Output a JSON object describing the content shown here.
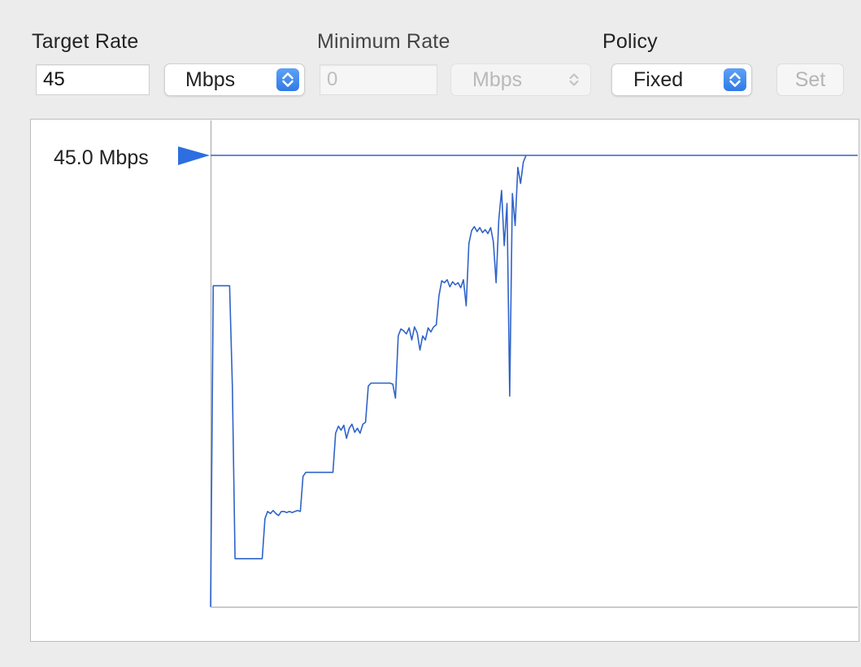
{
  "controls": {
    "target_rate": {
      "label": "Target Rate",
      "value": "45",
      "unit": "Mbps"
    },
    "minimum_rate": {
      "label": "Minimum Rate",
      "value": "",
      "placeholder": "0",
      "unit": "Mbps"
    },
    "policy": {
      "label": "Policy",
      "value": "Fixed"
    },
    "set_button_label": "Set"
  },
  "graph": {
    "target_line_label": "45.0 Mbps",
    "line_color": "#2f63c9",
    "marker_color": "#2d6fe0",
    "axis_color": "#b8b8b8"
  },
  "chart_data": {
    "type": "line",
    "target_mbps": 45.0,
    "series": [
      {
        "points": [
          [
            0,
            0
          ],
          [
            1,
            32.0
          ],
          [
            2,
            32.0
          ],
          [
            3,
            32.0
          ],
          [
            4,
            32.0
          ],
          [
            5,
            32.0
          ],
          [
            6,
            32.0
          ],
          [
            7,
            32.0
          ],
          [
            8,
            22.0
          ],
          [
            9,
            4.8
          ],
          [
            10,
            4.8
          ],
          [
            12,
            4.8
          ],
          [
            14,
            4.8
          ],
          [
            16,
            4.8
          ],
          [
            18,
            4.8
          ],
          [
            19,
            4.8
          ],
          [
            20,
            8.8
          ],
          [
            21,
            9.5
          ],
          [
            22,
            9.3
          ],
          [
            23,
            9.6
          ],
          [
            24,
            9.3
          ],
          [
            25,
            9.1
          ],
          [
            26,
            9.5
          ],
          [
            27,
            9.5
          ],
          [
            28,
            9.4
          ],
          [
            29,
            9.5
          ],
          [
            30,
            9.4
          ],
          [
            31,
            9.5
          ],
          [
            32,
            9.6
          ],
          [
            33,
            9.5
          ],
          [
            34,
            13.0
          ],
          [
            35,
            13.4
          ],
          [
            36,
            13.4
          ],
          [
            38,
            13.4
          ],
          [
            40,
            13.4
          ],
          [
            42,
            13.4
          ],
          [
            44,
            13.4
          ],
          [
            45,
            13.4
          ],
          [
            46,
            17.3
          ],
          [
            47,
            18.0
          ],
          [
            48,
            17.6
          ],
          [
            49,
            18.1
          ],
          [
            50,
            16.8
          ],
          [
            51,
            17.8
          ],
          [
            52,
            18.2
          ],
          [
            53,
            17.4
          ],
          [
            54,
            17.8
          ],
          [
            55,
            17.3
          ],
          [
            56,
            18.2
          ],
          [
            57,
            18.4
          ],
          [
            58,
            22.0
          ],
          [
            59,
            22.3
          ],
          [
            60,
            22.3
          ],
          [
            62,
            22.3
          ],
          [
            64,
            22.3
          ],
          [
            66,
            22.3
          ],
          [
            67,
            22.2
          ],
          [
            68,
            20.8
          ],
          [
            69,
            27.0
          ],
          [
            70,
            27.7
          ],
          [
            71,
            27.5
          ],
          [
            72,
            27.2
          ],
          [
            73,
            27.8
          ],
          [
            74,
            26.6
          ],
          [
            75,
            27.9
          ],
          [
            76,
            27.3
          ],
          [
            77,
            25.6
          ],
          [
            78,
            27.0
          ],
          [
            79,
            26.6
          ],
          [
            80,
            27.8
          ],
          [
            81,
            27.4
          ],
          [
            82,
            27.9
          ],
          [
            83,
            28.1
          ],
          [
            84,
            31.0
          ],
          [
            85,
            32.5
          ],
          [
            86,
            32.3
          ],
          [
            87,
            32.6
          ],
          [
            88,
            31.9
          ],
          [
            89,
            32.4
          ],
          [
            90,
            32.1
          ],
          [
            91,
            32.3
          ],
          [
            92,
            31.8
          ],
          [
            93,
            32.6
          ],
          [
            94,
            30.0
          ],
          [
            95,
            36.2
          ],
          [
            96,
            37.5
          ],
          [
            97,
            37.9
          ],
          [
            98,
            37.4
          ],
          [
            99,
            37.8
          ],
          [
            100,
            37.3
          ],
          [
            101,
            37.6
          ],
          [
            102,
            37.2
          ],
          [
            103,
            37.8
          ],
          [
            104,
            36.4
          ],
          [
            105,
            32.3
          ],
          [
            106,
            38.6
          ],
          [
            107,
            41.5
          ],
          [
            108,
            36.0
          ],
          [
            109,
            40.2
          ],
          [
            110,
            21.0
          ],
          [
            111,
            41.2
          ],
          [
            112,
            38.0
          ],
          [
            113,
            43.8
          ],
          [
            114,
            42.2
          ],
          [
            115,
            44.3
          ],
          [
            116,
            45.0
          ]
        ]
      }
    ],
    "xlim": [
      0,
      238
    ],
    "ylim": [
      0,
      45
    ]
  }
}
